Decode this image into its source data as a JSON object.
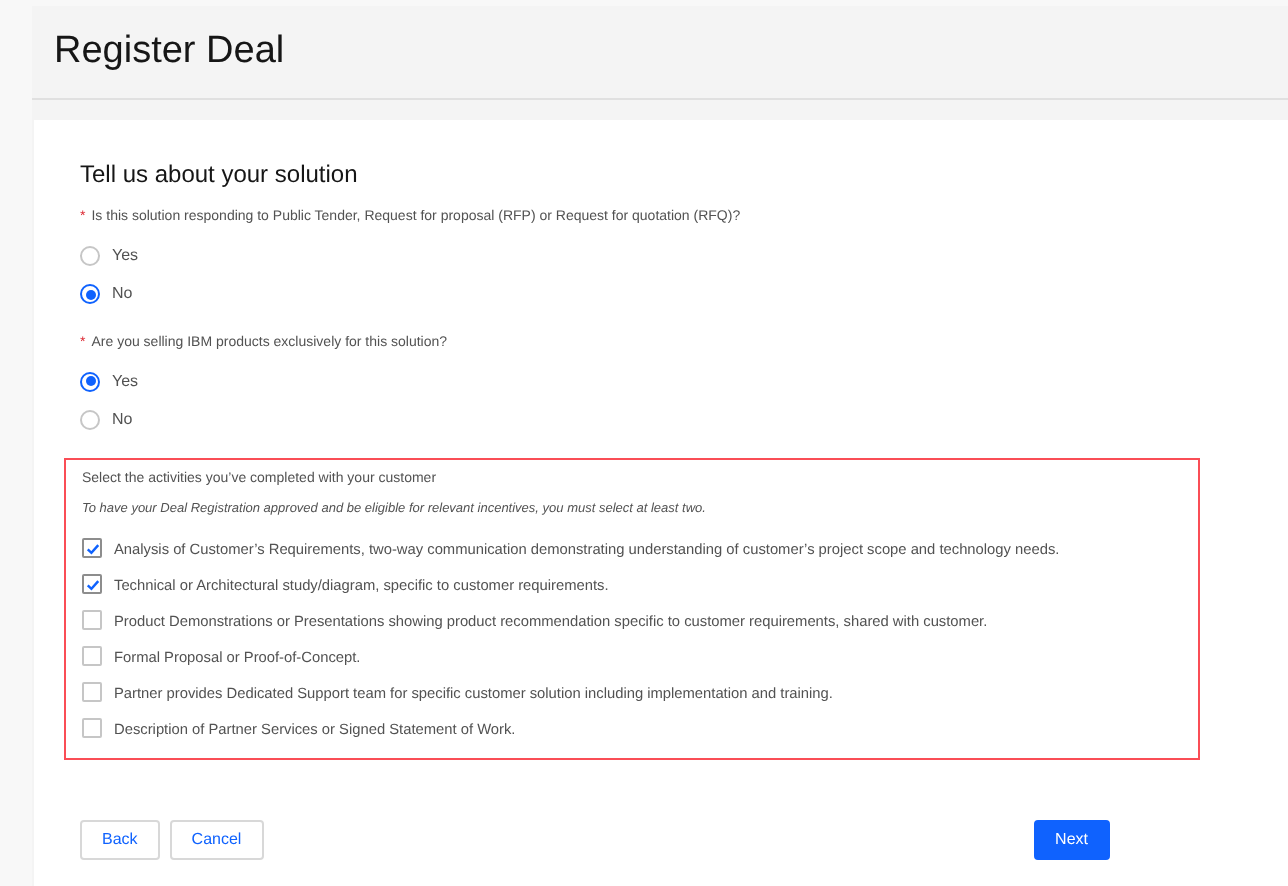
{
  "page": {
    "title": "Register Deal"
  },
  "section": {
    "title": "Tell us about your solution"
  },
  "questions": [
    {
      "required_mark": "*",
      "label": "Is this solution responding to Public Tender, Request for proposal (RFP) or Request for quotation (RFQ)?",
      "options": [
        {
          "label": "Yes",
          "selected": false
        },
        {
          "label": "No",
          "selected": true
        }
      ]
    },
    {
      "required_mark": "*",
      "label": "Are you selling IBM products exclusively for this solution?",
      "options": [
        {
          "label": "Yes",
          "selected": true
        },
        {
          "label": "No",
          "selected": false
        }
      ]
    }
  ],
  "activities": {
    "invalid": true,
    "label": "Select the activities you’ve completed with your customer",
    "hint": "To have your Deal Registration approved and be eligible for relevant incentives, you must select at least two.",
    "items": [
      {
        "label": "Analysis of Customer’s Requirements, two-way communication demonstrating understanding of customer’s project scope and technology needs.",
        "checked": true
      },
      {
        "label": "Technical or Architectural study/diagram, specific to customer requirements.",
        "checked": true
      },
      {
        "label": "Product Demonstrations or Presentations showing product recommendation specific to customer requirements, shared with customer.",
        "checked": false
      },
      {
        "label": "Formal Proposal or Proof-of-Concept.",
        "checked": false
      },
      {
        "label": "Partner provides Dedicated Support team for specific customer solution including implementation and training.",
        "checked": false
      },
      {
        "label": "Description of Partner Services or Signed Statement of Work.",
        "checked": false
      }
    ]
  },
  "buttons": [
    {
      "label": "Back",
      "kind": "secondary"
    },
    {
      "label": "Cancel",
      "kind": "secondary"
    },
    {
      "label": "Next",
      "kind": "primary"
    }
  ]
}
